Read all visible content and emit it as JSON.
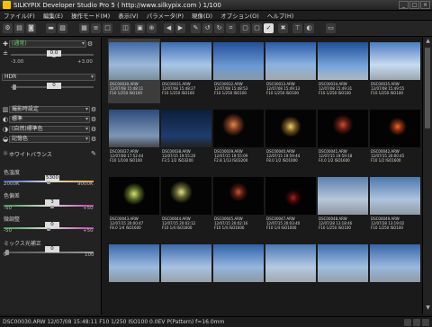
{
  "window": {
    "title": "SILKYPIX Developer Studio Pro 5 ( http://www.silkypix.com )   1/100"
  },
  "menu": [
    "ファイル(F)",
    "編集(E)",
    "操作モード(M)",
    "表示(V)",
    "パラメータ(P)",
    "現像(D)",
    "オプション(O)",
    "ヘルプ(H)"
  ],
  "left": {
    "preset": "(通常)",
    "exposure": {
      "value": "0.0",
      "min": "-3.00",
      "max": "+3.00"
    },
    "hdr": {
      "label": "HDR",
      "value": "0"
    },
    "style1": "撮影時設定",
    "style2": "標準",
    "style3": "(自然)標準色",
    "style4": "記憶色",
    "wb": {
      "title": "ホワイトバランス",
      "temp_label": "色温度",
      "temp_value": "5300",
      "temp_min": "2000K",
      "temp_max": "9000K",
      "tint_label": "色偏差",
      "tint_value": "3",
      "tint_min": "-50",
      "tint_max": "+50",
      "fine_label": "微調整",
      "fine_value": "0",
      "fine_min": "-50",
      "fine_max": "+50",
      "mix_label": "ミックス光補正",
      "mix_value": "0",
      "mix_min": "0",
      "mix_max": "100"
    }
  },
  "thumbs": [
    {
      "cap": "DSC00030.ARW\n12/07/08 15:48:11\nF10 1/250 ISO100",
      "bg": "linear-gradient(#3f6aa8,#9db9d9 60%,#7a8c9a)",
      "sel": true
    },
    {
      "cap": "DSC00031.ARW\n12/07/08 15:48:27\nF10 1/250 ISO100",
      "bg": "linear-gradient(#3b6db5,#a8c6e6 60%,#8a9aa8)"
    },
    {
      "cap": "DSC00032.ARW\n12/07/08 15:48:53\nF10 1/250 ISO100",
      "bg": "linear-gradient(#234f9c,#6c9bd3 65%,#8899a8)"
    },
    {
      "cap": "DSC00033.ARW\n12/07/08 15:49:13\nF10 1/250 ISO100",
      "bg": "linear-gradient(#2a5aa8,#8cb3e0 60%,#a2a8ae)"
    },
    {
      "cap": "DSC00034.ARW\n12/07/08 15:49:31\nF10 1/250 ISO100",
      "bg": "linear-gradient(#1f4f98,#7aa6dc 65%,#b0b8c0)"
    },
    {
      "cap": "DSC00035.ARW\n12/07/08 15:49:55\nF10 1/250 ISO100",
      "bg": "linear-gradient(#4a7cc0,#c7dbf0 60%,#9aa6b0)"
    },
    {
      "cap": "DSC00037.ARW\n12/07/08 17:52:44\nF10 1/100 ISO100",
      "bg": "linear-gradient(#2c4a7a,#7e96b8 70%,#444)"
    },
    {
      "cap": "DSC00038.ARW\n12/07/15 19:55:20\nF3.5 1/2 ISO3200",
      "bg": "linear-gradient(#0c1e3a,#1e3c6c 70%,#222)"
    },
    {
      "cap": "DSC00039.ARW\n12/07/15 19:55:09\nF2.8 1/13 ISO3200",
      "bg": "radial-gradient(circle at 40% 40%,#e08a40 0,#7a3a20 14%,#050505 30%)"
    },
    {
      "cap": "DSC00040.ARW\n12/07/15 19:59:44\nF8.0 1/2 ISO1000",
      "bg": "radial-gradient(circle at 50% 45%,#e8d070 0,#705020 16%,#040404 32%)"
    },
    {
      "cap": "DSC00041.ARW\n12/07/15 19:59:18\nF4.0 1/2 ISO1600",
      "bg": "radial-gradient(circle at 50% 40%,#cc5030 0,#5a1a10 15%,#030303 30%)"
    },
    {
      "cap": "DSC00042.ARW\n12/07/15 20:00:45\nF10 1/2 ISO1600",
      "bg": "radial-gradient(circle at 55% 45%,#f06a20 0,#7a2a10 12%,#030303 26%)"
    },
    {
      "cap": "DSC00043.ARW\n12/07/15 20:00:47\nF8.0 1/4 ISO1600",
      "bg": "radial-gradient(circle at 50% 45%,#d8e070 0,#506020 18%,#030303 34%)"
    },
    {
      "cap": "DSC00044.ARW\n12/07/15 20:02:12\nF10 1/4 ISO1600",
      "bg": "radial-gradient(circle at 40% 40%,#e0e090 0,#606030 14%,#040404 30%)"
    },
    {
      "cap": "DSC00045.ARW\n12/07/15 20:02:16\nF10 1/4 ISO1600",
      "bg": "radial-gradient(circle at 50% 40%,#c05a30 0,#501810 14%,#030303 28%)"
    },
    {
      "cap": "DSC00047.ARW\n12/07/15 20:03:40\nF10 1/4 ISO1000",
      "bg": "radial-gradient(circle at 55% 55%,#b02020 0,#400808 12%,#020202 24%)"
    },
    {
      "cap": "DSC00048.ARW\n12/07/28 13:18:46\nF10 1/250 ISO100",
      "bg": "linear-gradient(#5a80b0,#b8c8d8 60%,#8a94a0)"
    },
    {
      "cap": "DSC00049.ARW\n12/07/28 13:19:02\nF10 1/250 ISO100",
      "bg": "linear-gradient(#4a78b0,#aec4dc 60%,#909aa4)"
    },
    {
      "cap": "",
      "bg": "linear-gradient(#3868aa,#9cbade 60%,#8a96a2)"
    },
    {
      "cap": "",
      "bg": "linear-gradient(#3a6aac,#a8c2e0 60%,#98a2ac)"
    },
    {
      "cap": "",
      "bg": "linear-gradient(#2e62aa,#94b6de 60%,#8c98a4)"
    },
    {
      "cap": "",
      "bg": "linear-gradient(#4a78b4,#b4cae2 60%,#a0a8b0)"
    },
    {
      "cap": "",
      "bg": "linear-gradient(#3c6cae,#a0bedf 60%,#949ea8)"
    },
    {
      "cap": "",
      "bg": "linear-gradient(#3666a8,#9ab8dc 60%,#909aa6)"
    }
  ],
  "status": "DSC00030.ARW 12/07/08 15:48:11 F10 1/250 ISO100    0.0EV P(Pattern) f=16.0mm"
}
